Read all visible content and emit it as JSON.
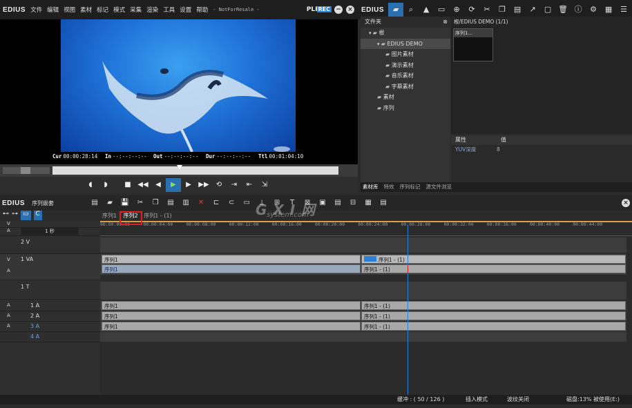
{
  "app": {
    "logo": "EDIUS",
    "plr": "PLR",
    "rec": "REC"
  },
  "menu": [
    "文件",
    "编辑",
    "视图",
    "素材",
    "标记",
    "模式",
    "采集",
    "渲染",
    "工具",
    "设置",
    "帮助"
  ],
  "menu_suffix": "- NotForResale -",
  "player": {
    "cur_label": "Cur",
    "cur": "00:00:28:14",
    "in_label": "In",
    "in": "--:--:--:--",
    "out_label": "Out",
    "out": "--:--:--:--",
    "dur_label": "Dur",
    "dur": "--:--:--:--",
    "ttl_label": "Ttl",
    "ttl": "00:01:04:10"
  },
  "bin": {
    "logo": "EDIUS",
    "folder_header": "文件夹",
    "folders": [
      {
        "label": "根",
        "indent": 1,
        "sel": false
      },
      {
        "label": "EDIUS DEMO",
        "indent": 2,
        "sel": true
      },
      {
        "label": "图片素材",
        "indent": 3,
        "sel": false
      },
      {
        "label": "演示素材",
        "indent": 3,
        "sel": false
      },
      {
        "label": "音乐素材",
        "indent": 3,
        "sel": false
      },
      {
        "label": "字幕素材",
        "indent": 3,
        "sel": false
      },
      {
        "label": "素材",
        "indent": 2,
        "sel": false
      },
      {
        "label": "序列",
        "indent": 2,
        "sel": false
      }
    ],
    "path": "根/EDIUS DEMO (1/1)",
    "clip_label": "序列1...",
    "prop_header": "属性",
    "value_header": "值",
    "prop_row_key": "YUV深度",
    "prop_row_val": "8",
    "tabs": [
      "素材库",
      "特效",
      "序列标记",
      "源文件浏览"
    ]
  },
  "timeline": {
    "logo": "EDIUS",
    "seq_name": "序列嵌套",
    "tabs": [
      "序列1",
      "序列2",
      "序列1 - (1)"
    ],
    "scale_label": "1 秒",
    "ruler": [
      "00:00:00:00",
      "00:00:04:00",
      "00:00:08:00",
      "00:00:12:00",
      "00:00:16:00",
      "00:00:20:00",
      "00:00:24:00",
      "00:00:28:00",
      "00:00:32:00",
      "00:00:36:00",
      "00:00:40:00",
      "00:00:44:00"
    ],
    "tracks": {
      "v2": "2 V",
      "va1": "1 VA",
      "t1": "1 T",
      "a1": "1 A",
      "a2": "2 A",
      "a3": "3 A",
      "a4": "4 A"
    },
    "clips": {
      "va_video_left": "序列1",
      "va_video_right": "序列1 - (1)",
      "va_audio_left": "序列1",
      "va_audio_right": "序列1 - (1)",
      "a1_left": "序列1",
      "a1_right": "序列1 - (1)",
      "a2_left": "序列1",
      "a2_right": "序列1 - (1)",
      "a3_left": "序列1",
      "a3_right": "序列1 - (1)"
    }
  },
  "status": {
    "buffer": "缓冲 : ( 50 / 126 )",
    "insert_mode": "插入模式",
    "ripple": "波纹关闭",
    "disk": "磁盘:13% 被使用(E:)"
  },
  "watermark": {
    "main": "G X I 网",
    "sub": "system.com"
  },
  "colors": {
    "accent": "#2a7fd6",
    "highlight_box": "#e02020",
    "play_green": "#7fe36a"
  }
}
